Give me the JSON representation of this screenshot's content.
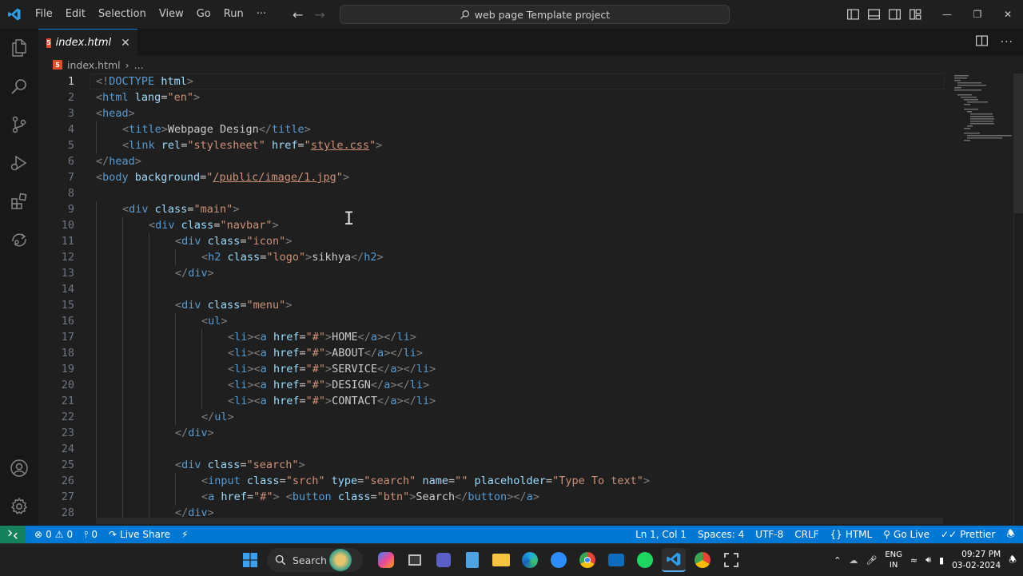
{
  "titlebar": {
    "menus": [
      "File",
      "Edit",
      "Selection",
      "View",
      "Go",
      "Run",
      "···"
    ],
    "command_center": "web page Template project",
    "window_controls": [
      "—",
      "❐",
      "✕"
    ]
  },
  "tab": {
    "label": "index.html",
    "close": "✕"
  },
  "breadcrumb": {
    "file": "index.html",
    "sep": "›",
    "more": "..."
  },
  "editor": {
    "active_line": 1,
    "lines": [
      {
        "n": "1",
        "indent": 0,
        "tokens": [
          [
            "br",
            "<!"
          ],
          [
            "kw",
            "DOCTYPE"
          ],
          [
            "txt",
            " "
          ],
          [
            "attr",
            "html"
          ],
          [
            "br",
            ">"
          ]
        ]
      },
      {
        "n": "2",
        "indent": 0,
        "tokens": [
          [
            "br",
            "<"
          ],
          [
            "tag",
            "html"
          ],
          [
            "txt",
            " "
          ],
          [
            "attr",
            "lang"
          ],
          [
            "txt",
            "="
          ],
          [
            "str",
            "\"en\""
          ],
          [
            "br",
            ">"
          ]
        ]
      },
      {
        "n": "3",
        "indent": 0,
        "tokens": [
          [
            "br",
            "<"
          ],
          [
            "tag",
            "head"
          ],
          [
            "br",
            ">"
          ]
        ]
      },
      {
        "n": "4",
        "indent": 1,
        "tokens": [
          [
            "br",
            "<"
          ],
          [
            "tag",
            "title"
          ],
          [
            "br",
            ">"
          ],
          [
            "txt",
            "Webpage Design"
          ],
          [
            "br",
            "</"
          ],
          [
            "tag",
            "title"
          ],
          [
            "br",
            ">"
          ]
        ]
      },
      {
        "n": "5",
        "indent": 1,
        "tokens": [
          [
            "br",
            "<"
          ],
          [
            "tag",
            "link"
          ],
          [
            "txt",
            " "
          ],
          [
            "attr",
            "rel"
          ],
          [
            "txt",
            "="
          ],
          [
            "str",
            "\"stylesheet\""
          ],
          [
            "txt",
            " "
          ],
          [
            "attr",
            "href"
          ],
          [
            "txt",
            "="
          ],
          [
            "str",
            "\""
          ],
          [
            "stru",
            "style.css"
          ],
          [
            "str",
            "\""
          ],
          [
            "br",
            ">"
          ]
        ]
      },
      {
        "n": "6",
        "indent": 0,
        "tokens": [
          [
            "br",
            "</"
          ],
          [
            "tag",
            "head"
          ],
          [
            "br",
            ">"
          ]
        ]
      },
      {
        "n": "7",
        "indent": 0,
        "tokens": [
          [
            "br",
            "<"
          ],
          [
            "tag",
            "body"
          ],
          [
            "txt",
            " "
          ],
          [
            "attr",
            "background"
          ],
          [
            "txt",
            "="
          ],
          [
            "str",
            "\""
          ],
          [
            "stru",
            "/public/image/1.jpg"
          ],
          [
            "str",
            "\""
          ],
          [
            "br",
            ">"
          ]
        ]
      },
      {
        "n": "8",
        "indent": 0,
        "tokens": []
      },
      {
        "n": "9",
        "indent": 1,
        "tokens": [
          [
            "br",
            "<"
          ],
          [
            "tag",
            "div"
          ],
          [
            "txt",
            " "
          ],
          [
            "attr",
            "class"
          ],
          [
            "txt",
            "="
          ],
          [
            "str",
            "\"main\""
          ],
          [
            "br",
            ">"
          ]
        ]
      },
      {
        "n": "10",
        "indent": 2,
        "tokens": [
          [
            "br",
            "<"
          ],
          [
            "tag",
            "div"
          ],
          [
            "txt",
            " "
          ],
          [
            "attr",
            "class"
          ],
          [
            "txt",
            "="
          ],
          [
            "str",
            "\"navbar\""
          ],
          [
            "br",
            ">"
          ]
        ]
      },
      {
        "n": "11",
        "indent": 3,
        "tokens": [
          [
            "br",
            "<"
          ],
          [
            "tag",
            "div"
          ],
          [
            "txt",
            " "
          ],
          [
            "attr",
            "class"
          ],
          [
            "txt",
            "="
          ],
          [
            "str",
            "\"icon\""
          ],
          [
            "br",
            ">"
          ]
        ]
      },
      {
        "n": "12",
        "indent": 4,
        "tokens": [
          [
            "br",
            "<"
          ],
          [
            "tag",
            "h2"
          ],
          [
            "txt",
            " "
          ],
          [
            "attr",
            "class"
          ],
          [
            "txt",
            "="
          ],
          [
            "str",
            "\"logo\""
          ],
          [
            "br",
            ">"
          ],
          [
            "txt",
            "sikhya"
          ],
          [
            "br",
            "</"
          ],
          [
            "tag",
            "h2"
          ],
          [
            "br",
            ">"
          ]
        ]
      },
      {
        "n": "13",
        "indent": 3,
        "tokens": [
          [
            "br",
            "</"
          ],
          [
            "tag",
            "div"
          ],
          [
            "br",
            ">"
          ]
        ]
      },
      {
        "n": "14",
        "indent": 0,
        "tokens": []
      },
      {
        "n": "15",
        "indent": 3,
        "tokens": [
          [
            "br",
            "<"
          ],
          [
            "tag",
            "div"
          ],
          [
            "txt",
            " "
          ],
          [
            "attr",
            "class"
          ],
          [
            "txt",
            "="
          ],
          [
            "str",
            "\"menu\""
          ],
          [
            "br",
            ">"
          ]
        ]
      },
      {
        "n": "16",
        "indent": 4,
        "tokens": [
          [
            "br",
            "<"
          ],
          [
            "tag",
            "ul"
          ],
          [
            "br",
            ">"
          ]
        ]
      },
      {
        "n": "17",
        "indent": 5,
        "tokens": [
          [
            "br",
            "<"
          ],
          [
            "tag",
            "li"
          ],
          [
            "br",
            "><"
          ],
          [
            "tag",
            "a"
          ],
          [
            "txt",
            " "
          ],
          [
            "attr",
            "href"
          ],
          [
            "txt",
            "="
          ],
          [
            "str",
            "\"#\""
          ],
          [
            "br",
            ">"
          ],
          [
            "txt",
            "HOME"
          ],
          [
            "br",
            "</"
          ],
          [
            "tag",
            "a"
          ],
          [
            "br",
            "></"
          ],
          [
            "tag",
            "li"
          ],
          [
            "br",
            ">"
          ]
        ]
      },
      {
        "n": "18",
        "indent": 5,
        "tokens": [
          [
            "br",
            "<"
          ],
          [
            "tag",
            "li"
          ],
          [
            "br",
            "><"
          ],
          [
            "tag",
            "a"
          ],
          [
            "txt",
            " "
          ],
          [
            "attr",
            "href"
          ],
          [
            "txt",
            "="
          ],
          [
            "str",
            "\"#\""
          ],
          [
            "br",
            ">"
          ],
          [
            "txt",
            "ABOUT"
          ],
          [
            "br",
            "</"
          ],
          [
            "tag",
            "a"
          ],
          [
            "br",
            "></"
          ],
          [
            "tag",
            "li"
          ],
          [
            "br",
            ">"
          ]
        ]
      },
      {
        "n": "19",
        "indent": 5,
        "tokens": [
          [
            "br",
            "<"
          ],
          [
            "tag",
            "li"
          ],
          [
            "br",
            "><"
          ],
          [
            "tag",
            "a"
          ],
          [
            "txt",
            " "
          ],
          [
            "attr",
            "href"
          ],
          [
            "txt",
            "="
          ],
          [
            "str",
            "\"#\""
          ],
          [
            "br",
            ">"
          ],
          [
            "txt",
            "SERVICE"
          ],
          [
            "br",
            "</"
          ],
          [
            "tag",
            "a"
          ],
          [
            "br",
            "></"
          ],
          [
            "tag",
            "li"
          ],
          [
            "br",
            ">"
          ]
        ]
      },
      {
        "n": "20",
        "indent": 5,
        "tokens": [
          [
            "br",
            "<"
          ],
          [
            "tag",
            "li"
          ],
          [
            "br",
            "><"
          ],
          [
            "tag",
            "a"
          ],
          [
            "txt",
            " "
          ],
          [
            "attr",
            "href"
          ],
          [
            "txt",
            "="
          ],
          [
            "str",
            "\"#\""
          ],
          [
            "br",
            ">"
          ],
          [
            "txt",
            "DESIGN"
          ],
          [
            "br",
            "</"
          ],
          [
            "tag",
            "a"
          ],
          [
            "br",
            "></"
          ],
          [
            "tag",
            "li"
          ],
          [
            "br",
            ">"
          ]
        ]
      },
      {
        "n": "21",
        "indent": 5,
        "tokens": [
          [
            "br",
            "<"
          ],
          [
            "tag",
            "li"
          ],
          [
            "br",
            "><"
          ],
          [
            "tag",
            "a"
          ],
          [
            "txt",
            " "
          ],
          [
            "attr",
            "href"
          ],
          [
            "txt",
            "="
          ],
          [
            "str",
            "\"#\""
          ],
          [
            "br",
            ">"
          ],
          [
            "txt",
            "CONTACT"
          ],
          [
            "br",
            "</"
          ],
          [
            "tag",
            "a"
          ],
          [
            "br",
            "></"
          ],
          [
            "tag",
            "li"
          ],
          [
            "br",
            ">"
          ]
        ]
      },
      {
        "n": "22",
        "indent": 4,
        "tokens": [
          [
            "br",
            "</"
          ],
          [
            "tag",
            "ul"
          ],
          [
            "br",
            ">"
          ]
        ]
      },
      {
        "n": "23",
        "indent": 3,
        "tokens": [
          [
            "br",
            "</"
          ],
          [
            "tag",
            "div"
          ],
          [
            "br",
            ">"
          ]
        ]
      },
      {
        "n": "24",
        "indent": 0,
        "tokens": []
      },
      {
        "n": "25",
        "indent": 3,
        "tokens": [
          [
            "br",
            "<"
          ],
          [
            "tag",
            "div"
          ],
          [
            "txt",
            " "
          ],
          [
            "attr",
            "class"
          ],
          [
            "txt",
            "="
          ],
          [
            "str",
            "\"search\""
          ],
          [
            "br",
            ">"
          ]
        ]
      },
      {
        "n": "26",
        "indent": 4,
        "tokens": [
          [
            "br",
            "<"
          ],
          [
            "tag",
            "input"
          ],
          [
            "txt",
            " "
          ],
          [
            "attr",
            "class"
          ],
          [
            "txt",
            "="
          ],
          [
            "str",
            "\"srch\""
          ],
          [
            "txt",
            " "
          ],
          [
            "attr",
            "type"
          ],
          [
            "txt",
            "="
          ],
          [
            "str",
            "\"search\""
          ],
          [
            "txt",
            " "
          ],
          [
            "attr",
            "name"
          ],
          [
            "txt",
            "="
          ],
          [
            "str",
            "\"\""
          ],
          [
            "txt",
            " "
          ],
          [
            "attr",
            "placeholder"
          ],
          [
            "txt",
            "="
          ],
          [
            "str",
            "\"Type To text\""
          ],
          [
            "br",
            ">"
          ]
        ]
      },
      {
        "n": "27",
        "indent": 4,
        "tokens": [
          [
            "br",
            "<"
          ],
          [
            "tag",
            "a"
          ],
          [
            "txt",
            " "
          ],
          [
            "attr",
            "href"
          ],
          [
            "txt",
            "="
          ],
          [
            "str",
            "\"#\""
          ],
          [
            "br",
            ">"
          ],
          [
            "txt",
            " "
          ],
          [
            "br",
            "<"
          ],
          [
            "tag",
            "button"
          ],
          [
            "txt",
            " "
          ],
          [
            "attr",
            "class"
          ],
          [
            "txt",
            "="
          ],
          [
            "str",
            "\"btn\""
          ],
          [
            "br",
            ">"
          ],
          [
            "txt",
            "Search"
          ],
          [
            "br",
            "</"
          ],
          [
            "tag",
            "button"
          ],
          [
            "br",
            "></"
          ],
          [
            "tag",
            "a"
          ],
          [
            "br",
            ">"
          ]
        ]
      },
      {
        "n": "28",
        "indent": 3,
        "tokens": [
          [
            "br",
            "</"
          ],
          [
            "tag",
            "div"
          ],
          [
            "br",
            ">"
          ]
        ]
      }
    ]
  },
  "statusbar": {
    "errors": "0",
    "warnings": "0",
    "ports": "0",
    "live_share": "Live Share",
    "position": "Ln 1, Col 1",
    "spaces": "Spaces: 4",
    "encoding": "UTF-8",
    "eol": "CRLF",
    "language": "HTML",
    "go_live": "Go Live",
    "prettier": "Prettier"
  },
  "taskbar": {
    "search": "Search",
    "lang_top": "ENG",
    "lang_bottom": "IN",
    "time": "09:27 PM",
    "date": "03-02-2024"
  },
  "colors": {
    "accent": "#0078d4",
    "remote": "#16825d",
    "tag": "#569cd6",
    "attr": "#9cdcfe",
    "string": "#ce9178"
  }
}
